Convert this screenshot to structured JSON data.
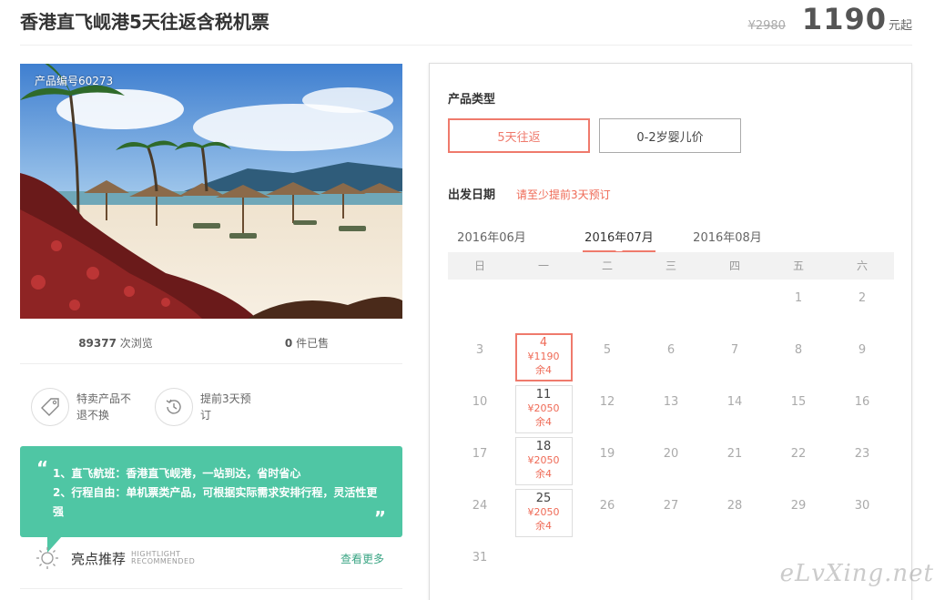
{
  "header": {
    "title": "香港直飞岘港5天往返含税机票",
    "old_price": "¥2980",
    "price": "1190",
    "price_unit": "元起"
  },
  "product": {
    "code_label": "产品编号60273",
    "views_count": "89377",
    "views_label": "次浏览",
    "sold_count": "0",
    "sold_label": "件已售",
    "features": [
      {
        "icon": "tag-icon",
        "text": "特卖产品不退不换"
      },
      {
        "icon": "clock-history-icon",
        "text": "提前3天预订"
      }
    ]
  },
  "highlights": {
    "lines": [
      "1、直飞航班：香港直飞岘港，一站到达，省时省心",
      "2、行程自由：单机票类产品，可根据实际需求安排行程，灵活性更强"
    ],
    "title": "亮点推荐",
    "title_en_1": "HIGHTLIGHT",
    "title_en_2": "RECOMMENDED",
    "more": "查看更多"
  },
  "booking": {
    "type_label": "产品类型",
    "types": [
      {
        "label": "5天往返",
        "active": true
      },
      {
        "label": "0-2岁婴儿价",
        "active": false
      }
    ],
    "date_label": "出发日期",
    "date_hint": "请至少提前3天预订",
    "months": [
      "2016年06月",
      "2016年07月",
      "2016年08月"
    ],
    "active_month": 1,
    "weekdays": [
      "日",
      "一",
      "二",
      "三",
      "四",
      "五",
      "六"
    ],
    "calendar": [
      [
        null,
        null,
        null,
        null,
        null,
        {
          "day": "1"
        },
        {
          "day": "2"
        }
      ],
      [
        {
          "day": "3"
        },
        {
          "day": "4",
          "price": "¥1190",
          "stock": "余4",
          "selected": true
        },
        {
          "day": "5"
        },
        {
          "day": "6"
        },
        {
          "day": "7"
        },
        {
          "day": "8"
        },
        {
          "day": "9"
        }
      ],
      [
        {
          "day": "10"
        },
        {
          "day": "11",
          "price": "¥2050",
          "stock": "余4"
        },
        {
          "day": "12"
        },
        {
          "day": "13"
        },
        {
          "day": "14"
        },
        {
          "day": "15"
        },
        {
          "day": "16"
        }
      ],
      [
        {
          "day": "17"
        },
        {
          "day": "18",
          "price": "¥2050",
          "stock": "余4"
        },
        {
          "day": "19"
        },
        {
          "day": "20"
        },
        {
          "day": "21"
        },
        {
          "day": "22"
        },
        {
          "day": "23"
        }
      ],
      [
        {
          "day": "24"
        },
        {
          "day": "25",
          "price": "¥2050",
          "stock": "余4"
        },
        {
          "day": "26"
        },
        {
          "day": "27"
        },
        {
          "day": "28"
        },
        {
          "day": "29"
        },
        {
          "day": "30"
        }
      ],
      [
        {
          "day": "31"
        },
        null,
        null,
        null,
        null,
        null,
        null
      ]
    ]
  },
  "watermark": "eLvXing.net",
  "colors": {
    "accent": "#ef7a6c",
    "highlight_bg": "#4fc6a4",
    "link": "#3aa584"
  }
}
